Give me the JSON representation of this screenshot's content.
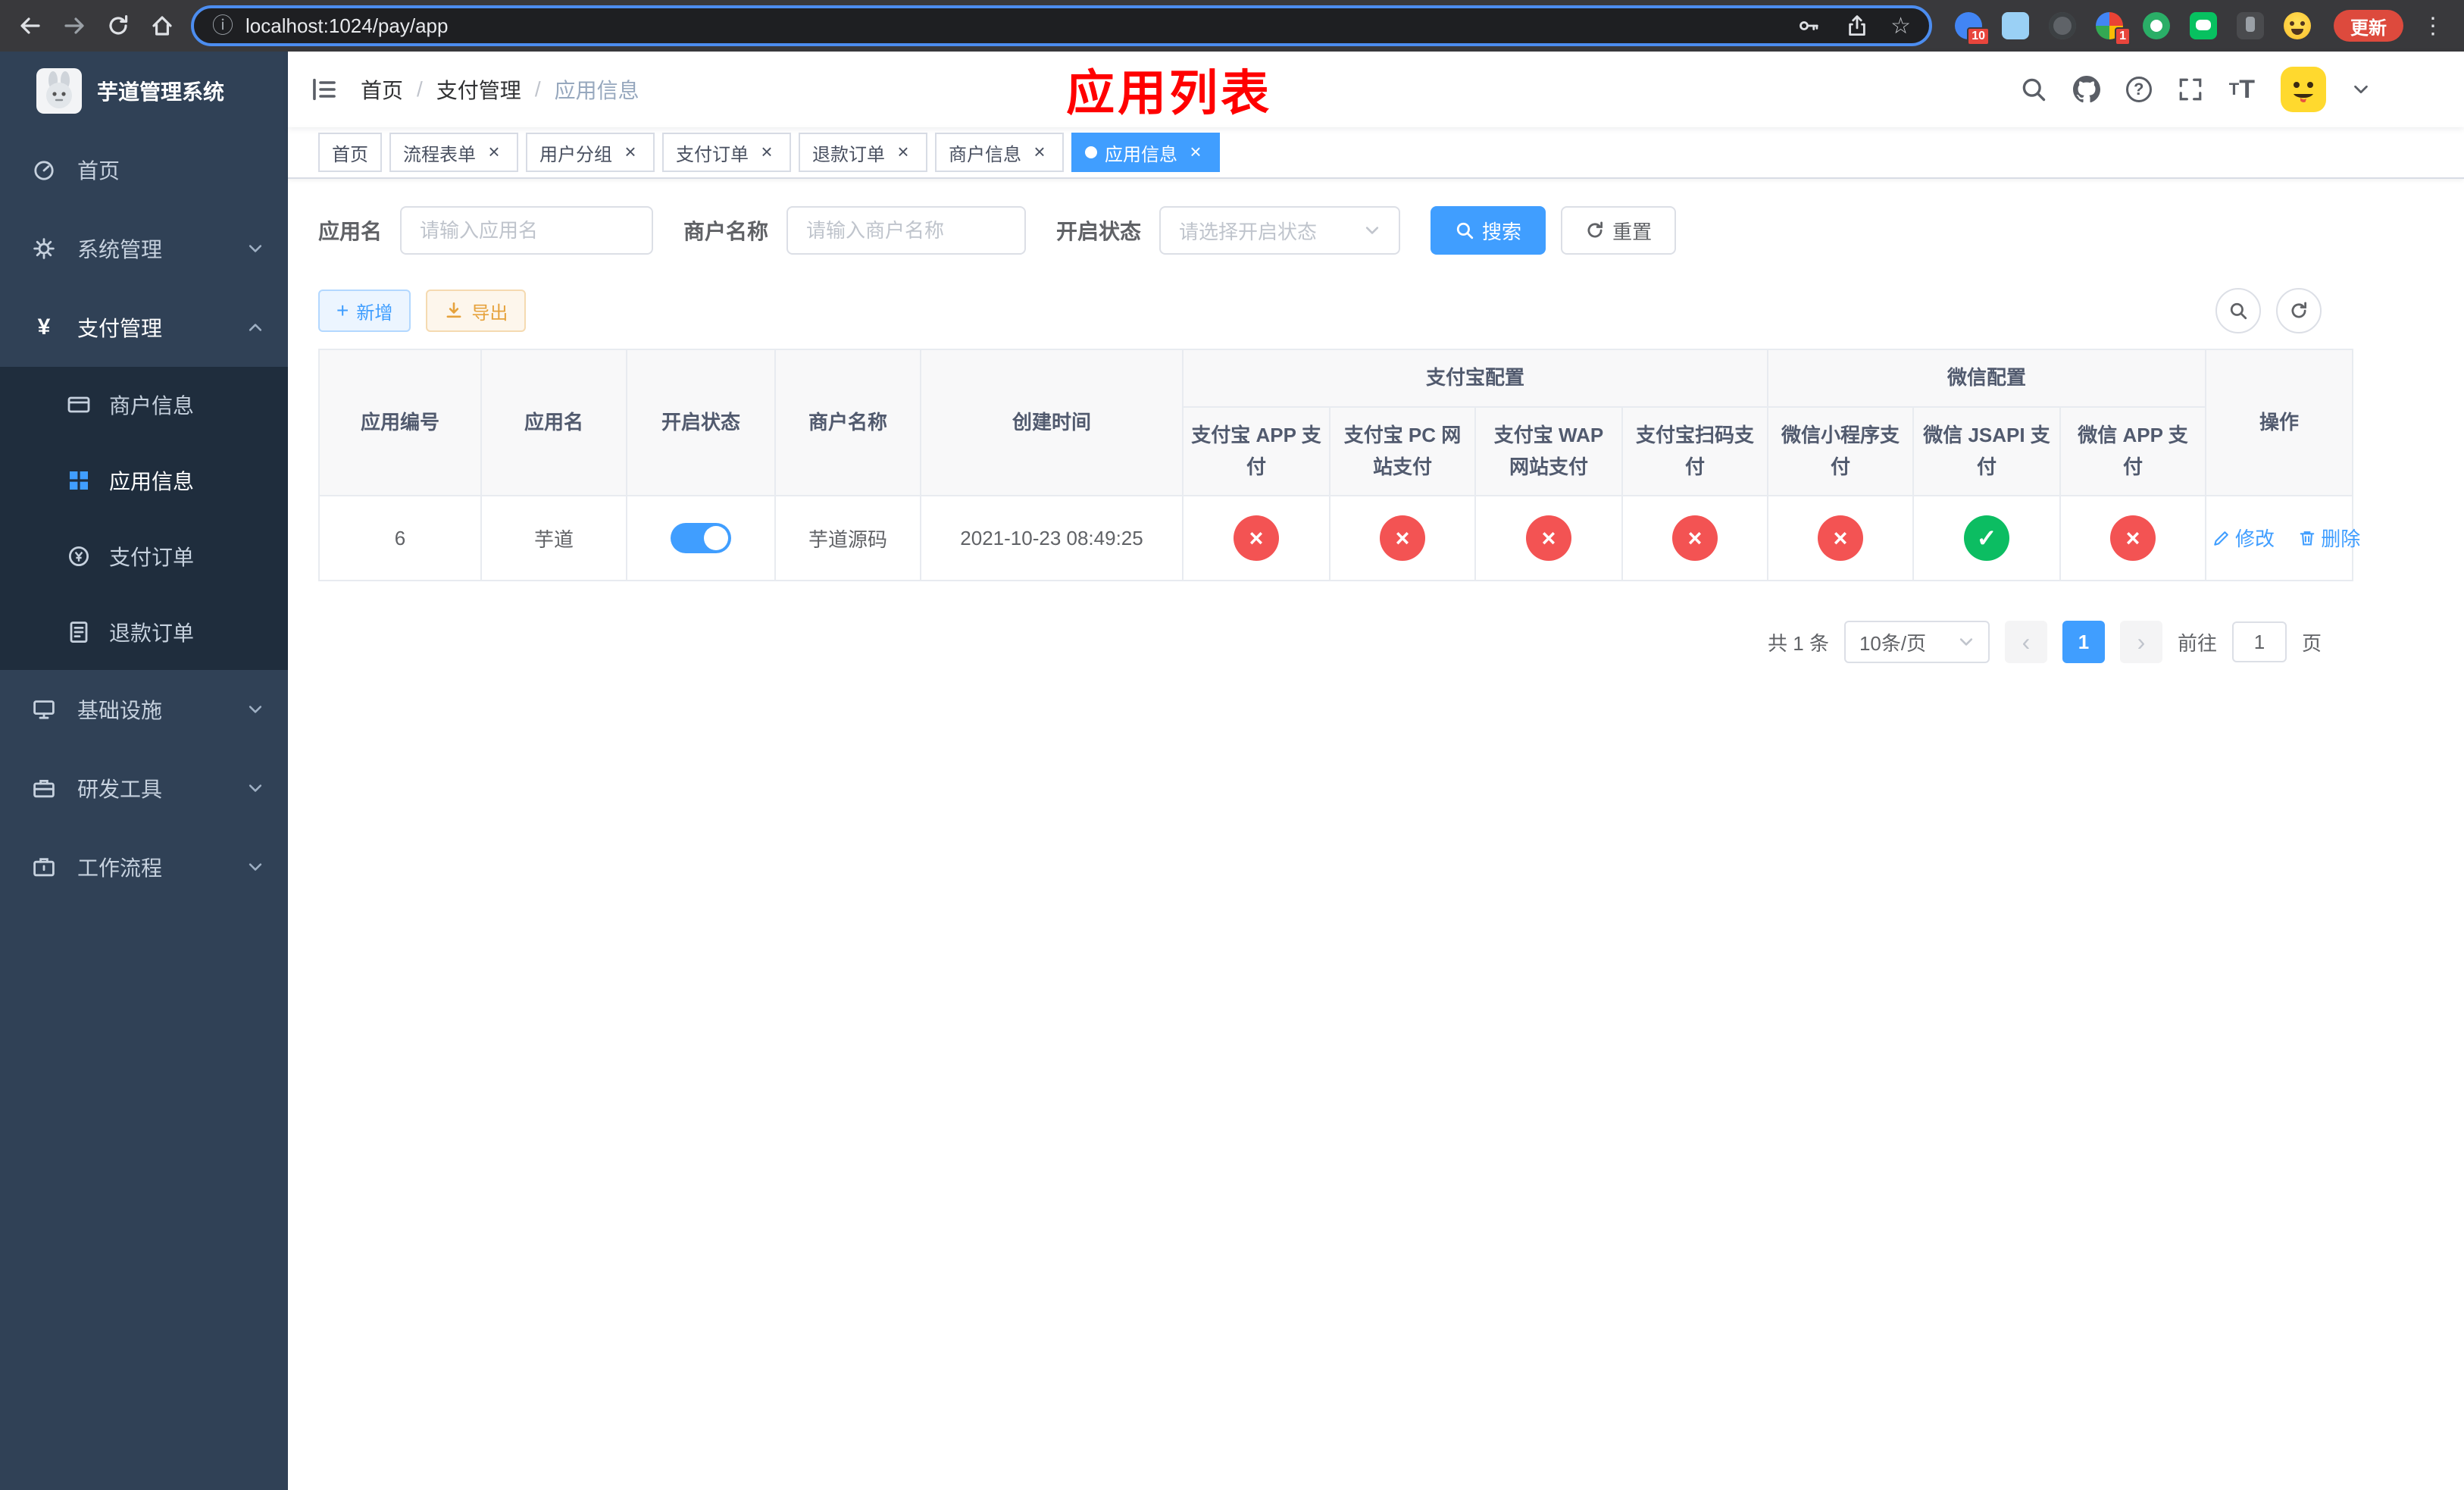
{
  "browser": {
    "url": "localhost:1024/pay/app",
    "update_button": "更新",
    "extension_badges": {
      "first": "10",
      "second": "1"
    }
  },
  "sidebar": {
    "logo_title": "芋道管理系统",
    "menu": [
      {
        "label": "首页"
      },
      {
        "label": "系统管理"
      },
      {
        "label": "支付管理"
      },
      {
        "label": "基础设施"
      },
      {
        "label": "研发工具"
      },
      {
        "label": "工作流程"
      }
    ],
    "submenu": [
      {
        "label": "商户信息"
      },
      {
        "label": "应用信息"
      },
      {
        "label": "支付订单"
      },
      {
        "label": "退款订单"
      }
    ]
  },
  "header": {
    "breadcrumb": [
      "首页",
      "支付管理",
      "应用信息"
    ],
    "page_title": "应用列表"
  },
  "tabs": [
    {
      "label": "首页"
    },
    {
      "label": "流程表单"
    },
    {
      "label": "用户分组"
    },
    {
      "label": "支付订单"
    },
    {
      "label": "退款订单"
    },
    {
      "label": "商户信息"
    },
    {
      "label": "应用信息"
    }
  ],
  "filters": {
    "app_name_label": "应用名",
    "app_name_placeholder": "请输入应用名",
    "merchant_label": "商户名称",
    "merchant_placeholder": "请输入商户名称",
    "status_label": "开启状态",
    "status_placeholder": "请选择开启状态",
    "search_button": "搜索",
    "reset_button": "重置"
  },
  "toolbar": {
    "add_button": "新增",
    "export_button": "导出"
  },
  "table": {
    "columns": {
      "app_id": "应用编号",
      "app_name": "应用名",
      "status": "开启状态",
      "merchant_name": "商户名称",
      "create_time": "创建时间",
      "alipay_group": "支付宝配置",
      "wechat_group": "微信配置",
      "alipay_app": "支付宝 APP 支付",
      "alipay_pc": "支付宝 PC 网站支付",
      "alipay_wap": "支付宝 WAP 网站支付",
      "alipay_qr": "支付宝扫码支付",
      "wx_lite": "微信小程序支付",
      "wx_jsapi": "微信 JSAPI 支付",
      "wx_app": "微信 APP 支付",
      "actions": "操作"
    },
    "rows": [
      {
        "app_id": "6",
        "app_name": "芋道",
        "enabled": true,
        "merchant_name": "芋道源码",
        "create_time": "2021-10-23 08:49:25",
        "pay_status": {
          "alipay_app": "no",
          "alipay_pc": "no",
          "alipay_wap": "no",
          "alipay_qr": "no",
          "wx_lite": "no",
          "wx_jsapi": "yes",
          "wx_app": "no"
        },
        "edit_label": "修改",
        "delete_label": "删除"
      }
    ]
  },
  "pagination": {
    "total_text": "共 1 条",
    "page_size": "10条/页",
    "current_page": "1",
    "goto_label": "前往",
    "goto_value": "1",
    "goto_suffix": "页"
  }
}
